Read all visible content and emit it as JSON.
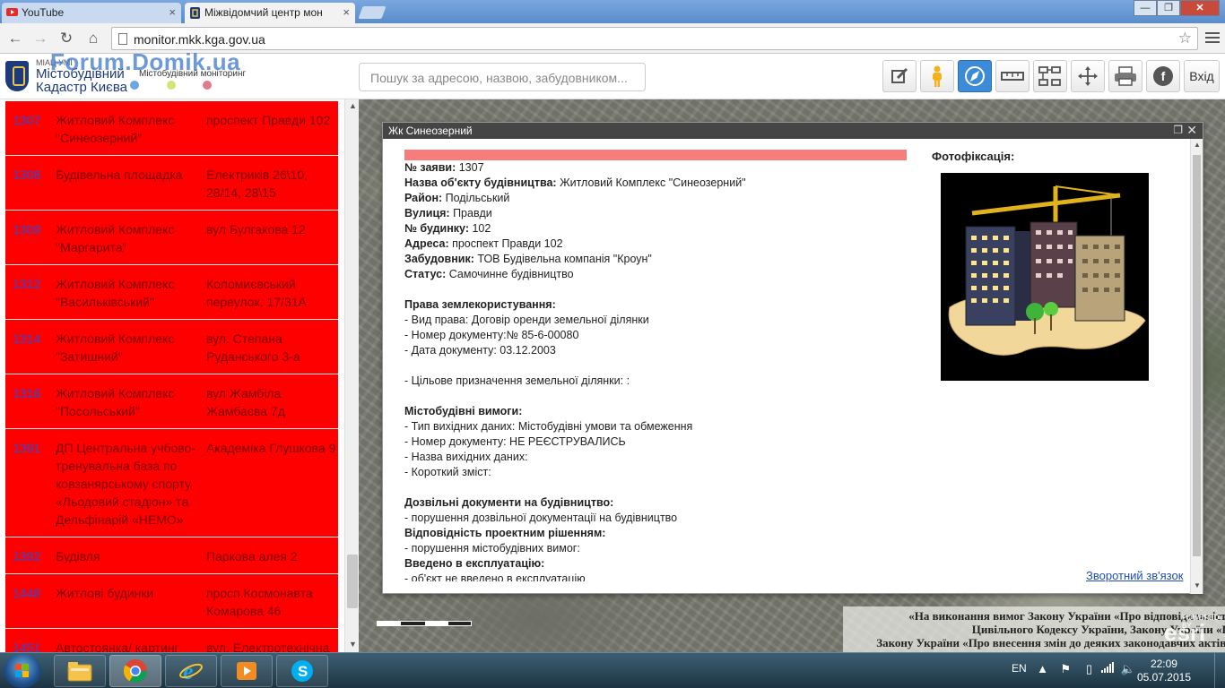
{
  "browser": {
    "tabs": [
      {
        "label": "YouTube",
        "icon": "youtube-icon",
        "active": false
      },
      {
        "label": "Міжвідомчий центр мон",
        "icon": "site-favicon",
        "active": true
      }
    ],
    "url": "monitor.mkk.kga.gov.ua",
    "window_controls": {
      "minimize": "—",
      "maximize": "❐",
      "close": "✕"
    }
  },
  "app": {
    "logo_sub": "МІАЦ УМІ",
    "logo_line1": "Містобудівний",
    "logo_line2": "Кадастр Києва",
    "logo_monitoring": "Містобудівний моніторинг",
    "watermark": "Forum.Domik.ua",
    "search_placeholder": "Пошук за адресою, назвою, забудовником...",
    "login_label": "Вхід",
    "tools": [
      "edit-icon",
      "street-view-person-icon",
      "compass-icon",
      "ruler-measure-icon",
      "layers-tree-icon",
      "move-pan-icon",
      "print-icon",
      "facebook-icon"
    ],
    "colors": {
      "list_bg": "#ff0000",
      "id_text": "#2b4bd8",
      "row_text": "#7a0000",
      "active_tool": "#3c8bd8"
    }
  },
  "list": [
    {
      "id": "1307",
      "name": "Житловий Комплекс \"Синеозерний\"",
      "address": "проспект Правди 102"
    },
    {
      "id": "1308",
      "name": "Будівельна площадка",
      "address": "Електриків 26\\10, 28/14, 28\\15"
    },
    {
      "id": "1309",
      "name": "Житловий Комплекс \"Маргарита\"",
      "address": "вул Булгакова 12"
    },
    {
      "id": "1312",
      "name": "Житловий Комплекс \"Васильківський\"",
      "address": "Коломиєвський переулок, 17/31А"
    },
    {
      "id": "1314",
      "name": "Житловий Комплекс \"Затишний\"",
      "address": "вул. Степана Руданського 3-а"
    },
    {
      "id": "1316",
      "name": "Житловий Комплекс \"Посольський\"",
      "address": "вул Жамбіла Жамбаєва 7д"
    },
    {
      "id": "1391",
      "name": "ДП Центральна учбово-тренувальна база по ковзанярському спорту «Льодовий стадіон» та Дельфінарій «НЕМО»",
      "address": "Академіка Глушкова 9"
    },
    {
      "id": "1392",
      "name": "Будівля",
      "address": "Паркова алея 2"
    },
    {
      "id": "1448",
      "name": "Житлові будинки",
      "address": "просп.Космонавта Комарова 46"
    },
    {
      "id": "1451",
      "name": "Автостоянка/ картинг",
      "address": "вул. Електротехнічна"
    }
  ],
  "popup": {
    "title": "Жк Синеозерний",
    "photo_title": "Фотофіксація:",
    "photo_icon": "construction-buildings-crane-icon",
    "feedback_link": "Зворотний зв'язок",
    "fields": [
      {
        "label": "№ заяви:",
        "value": " 1307"
      },
      {
        "label": "Назва об'єкту будівництва:",
        "value": " Житловий Комплекс \"Синеозерний\""
      },
      {
        "label": "Район:",
        "value": " Подільський"
      },
      {
        "label": "Вулиця:",
        "value": " Правди"
      },
      {
        "label": "№ будинку:",
        "value": " 102"
      },
      {
        "label": "Адреса:",
        "value": " проспект Правди 102"
      },
      {
        "label": "Забудовник:",
        "value": " ТОВ Будівельна компанія \"Кроун\""
      },
      {
        "label": "Статус:",
        "value": " Самочинне будівництво"
      }
    ],
    "land": {
      "heading": "Права землекористування:",
      "lines": [
        "- Вид права: Договір оренди земельної ділянки",
        "- Номер документу:№ 85-6-00080",
        "- Дата документу:  03.12.2003"
      ],
      "purpose": "- Цільове призначення земельної ділянки: :"
    },
    "urban": {
      "heading": "Містобудівні вимоги:",
      "lines": [
        "- Тип вихідних даних: Містобудівні умови та обмеження",
        "- Номер документу:        НЕ РЕЄСТРУВАЛИСЬ",
        "- Назва вихідних даних:",
        "- Короткий зміст:"
      ]
    },
    "permits": {
      "heading": "Дозвільні документи на будівництво:",
      "line": "- порушення дозвільної документації на будівництво"
    },
    "design": {
      "heading": "Відповідність проектним рішенням:",
      "line": "- порушення містобудівних вимог:"
    },
    "operation": {
      "heading": "Введено в експлуатацію:",
      "line": "- об'єкт не введено в експлуатацію"
    }
  },
  "map": {
    "legal_line1": "«На виконання вимог Закону України «Про відповідальність за правопорушення у сфері містобудівної діяльності»,",
    "legal_line2": "Цивільного Кодексу України, Закону України «Про регулювання містобудівної діяльності»,",
    "legal_line3": "Закону України «Про внесення змін до деяких законодавчих актів України щодо спрощення умов ведення бізнесу (дерегуляція)",
    "esri_powered": "POWERED BY",
    "esri_label": "esri"
  },
  "taskbar": {
    "apps": [
      "explorer-folder-icon",
      "chrome-icon",
      "internet-explorer-icon",
      "media-player-icon",
      "skype-icon"
    ],
    "language": "EN",
    "time": "22:09",
    "date": "05.07.2015"
  }
}
